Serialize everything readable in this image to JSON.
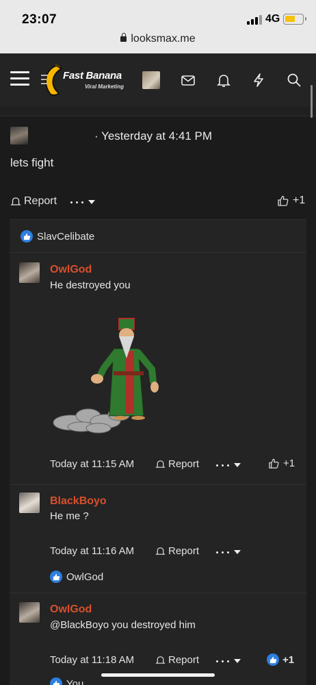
{
  "status_bar": {
    "time": "23:07",
    "network": "4G",
    "url": "looksmax.me"
  },
  "header": {
    "logo_title": "Fast Banana",
    "logo_subtitle": "Viral Marketing"
  },
  "post": {
    "time": "· Yesterday at 4:41 PM",
    "text": "lets fight",
    "report_label": "Report",
    "like_count": "+1"
  },
  "reaction_bar": {
    "user": "SlavCelibate"
  },
  "replies": [
    {
      "author": "OwlGod",
      "text": "He destroyed you",
      "time": "Today at 11:15 AM",
      "report_label": "Report",
      "like_count": "+1"
    },
    {
      "author": "BlackBoyo",
      "text": "He me ?",
      "time": "Today at 11:16 AM",
      "report_label": "Report",
      "reaction_user": "OwlGod"
    },
    {
      "author": "OwlGod",
      "text": "@BlackBoyo you destroyed him",
      "time": "Today at 11:18 AM",
      "report_label": "Report",
      "like_count": "+1",
      "reaction_user": "You"
    }
  ],
  "colors": {
    "author": "#d9502c",
    "like_blue": "#2d7fe0",
    "background": "#1b1b1b",
    "panel": "#242424"
  }
}
